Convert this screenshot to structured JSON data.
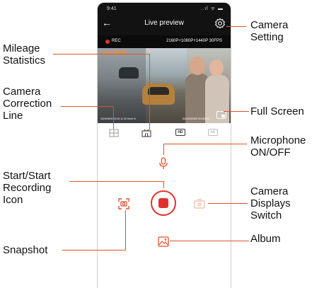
{
  "statusbar": {
    "time": "9:41",
    "icons": "..ıl ᯤ ▬"
  },
  "navbar": {
    "title": "Live preview"
  },
  "recbar": {
    "rec_label": "REC",
    "resolution": "2160P+1080P+1440P 30FPS"
  },
  "video": {
    "brand": "VANTRUE",
    "osd_left": "2023/09/02  19:00:12  32 Km/h  N",
    "osd_right": "SN:20230905  SN:B3505"
  },
  "toolbar": {
    "hd_label": "HD",
    "ar_label": "AR"
  },
  "annotations": {
    "camera_setting": [
      "Camera",
      "Setting"
    ],
    "mileage_statistics": [
      "Mileage",
      "Statistics"
    ],
    "camera_correction_line": [
      "Camera",
      "Correction",
      "Line"
    ],
    "full_screen": [
      "Full Screen"
    ],
    "microphone": [
      "Microphone",
      "ON/OFF"
    ],
    "start_recording": [
      "Start/Start",
      "Recording",
      "Icon"
    ],
    "camera_displays_switch": [
      "Camera",
      "Displays",
      "Switch"
    ],
    "album": [
      "Album"
    ],
    "snapshot": [
      "Snapshot"
    ]
  },
  "colors": {
    "accent": "#e0322c",
    "callout_line": "#e0522a",
    "topbar": "#121212"
  },
  "icons": [
    "back-arrow-icon",
    "gear-icon",
    "grid-icon",
    "road-line-icon",
    "fullscreen-icon",
    "microphone-icon",
    "record-icon",
    "snapshot-icon",
    "camera-switch-icon",
    "album-icon"
  ]
}
